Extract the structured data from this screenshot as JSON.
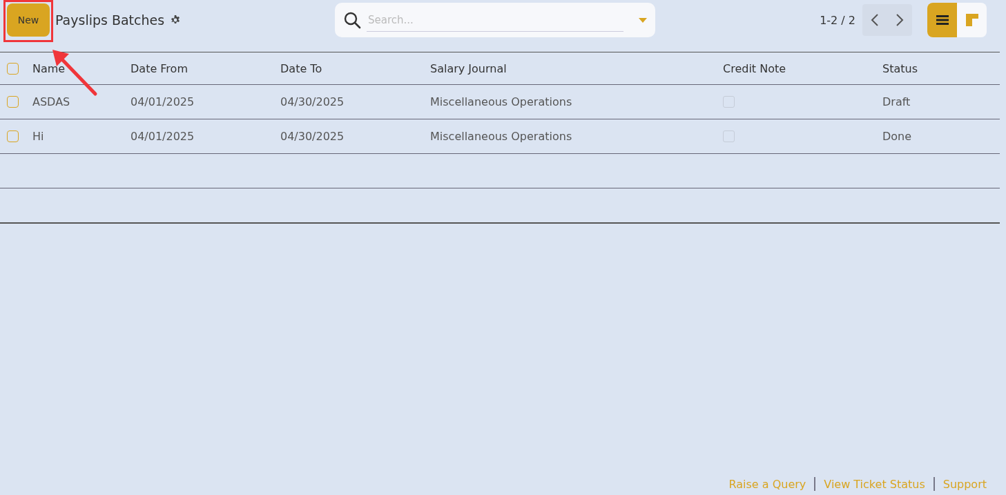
{
  "toolbar": {
    "new_button": "New",
    "title": "Payslips Batches",
    "search": {
      "placeholder": "Search..."
    },
    "pager": "1-2 / 2",
    "views": [
      {
        "kind": "list",
        "selected": true
      },
      {
        "kind": "kanban",
        "selected": false
      }
    ]
  },
  "table": {
    "select_all": {
      "checked": false
    },
    "columns": [
      "Name",
      "Date From",
      "Date To",
      "Salary Journal",
      "Credit Note",
      "Status"
    ],
    "rows": [
      {
        "checked": false,
        "name": "ASDAS",
        "date_from": "04/01/2025",
        "date_to": "04/30/2025",
        "salary_journal": "Miscellaneous Operations",
        "credit_note": false,
        "status": "Draft"
      },
      {
        "checked": false,
        "name": "Hi",
        "date_from": "04/01/2025",
        "date_to": "04/30/2025",
        "salary_journal": "Miscellaneous Operations",
        "credit_note": false,
        "status": "Done"
      }
    ]
  },
  "footer_links": [
    "Raise a Query",
    "View Ticket Status",
    "Support"
  ]
}
